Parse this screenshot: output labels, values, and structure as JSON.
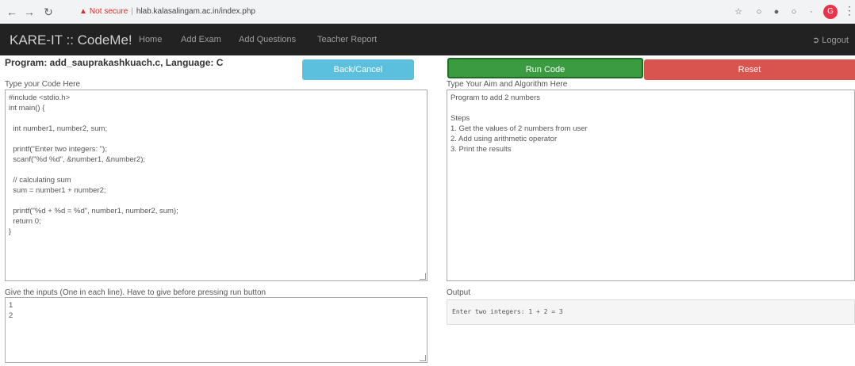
{
  "browser": {
    "security_label": "Not secure",
    "url": "hlab.kalasalingam.ac.in/index.php"
  },
  "navbar": {
    "brand": "KARE-IT :: CodeMe!",
    "links": [
      "Home",
      "Add Exam",
      "Add Questions",
      "Teacher Report"
    ],
    "logout": "Logout"
  },
  "program": {
    "header": "Program: add_sauprakashkuach.c, Language: C"
  },
  "buttons": {
    "back": "Back/Cancel",
    "run": "Run Code",
    "reset": "Reset"
  },
  "code_panel": {
    "label": "Type your Code Here",
    "lines": [
      "#include <stdio.h>",
      "int main() {",
      "",
      "  int number1, number2, sum;",
      "",
      "  printf(\"Enter two integers: \");",
      "  scanf(\"%d %d\", &number1, &number2);",
      "",
      "  // calculating sum",
      "  sum = number1 + number2;",
      "",
      "  printf(\"%d + %d = %d\", number1, number2, sum);",
      "  return 0;",
      "}"
    ]
  },
  "aim_panel": {
    "label": "Type Your Aim and Algorithm Here",
    "lines": [
      "Program to add 2 numbers",
      "",
      "Steps",
      "1. Get the values of 2 numbers from user",
      "2. Add using arithmetic operator",
      "3. Print the results"
    ]
  },
  "inputs_panel": {
    "label": "Give the inputs (One in each line). Have to give before pressing run button",
    "lines": [
      "1",
      "2"
    ]
  },
  "output_panel": {
    "label": "Output",
    "text": "Enter two integers: 1 + 2 = 3"
  }
}
